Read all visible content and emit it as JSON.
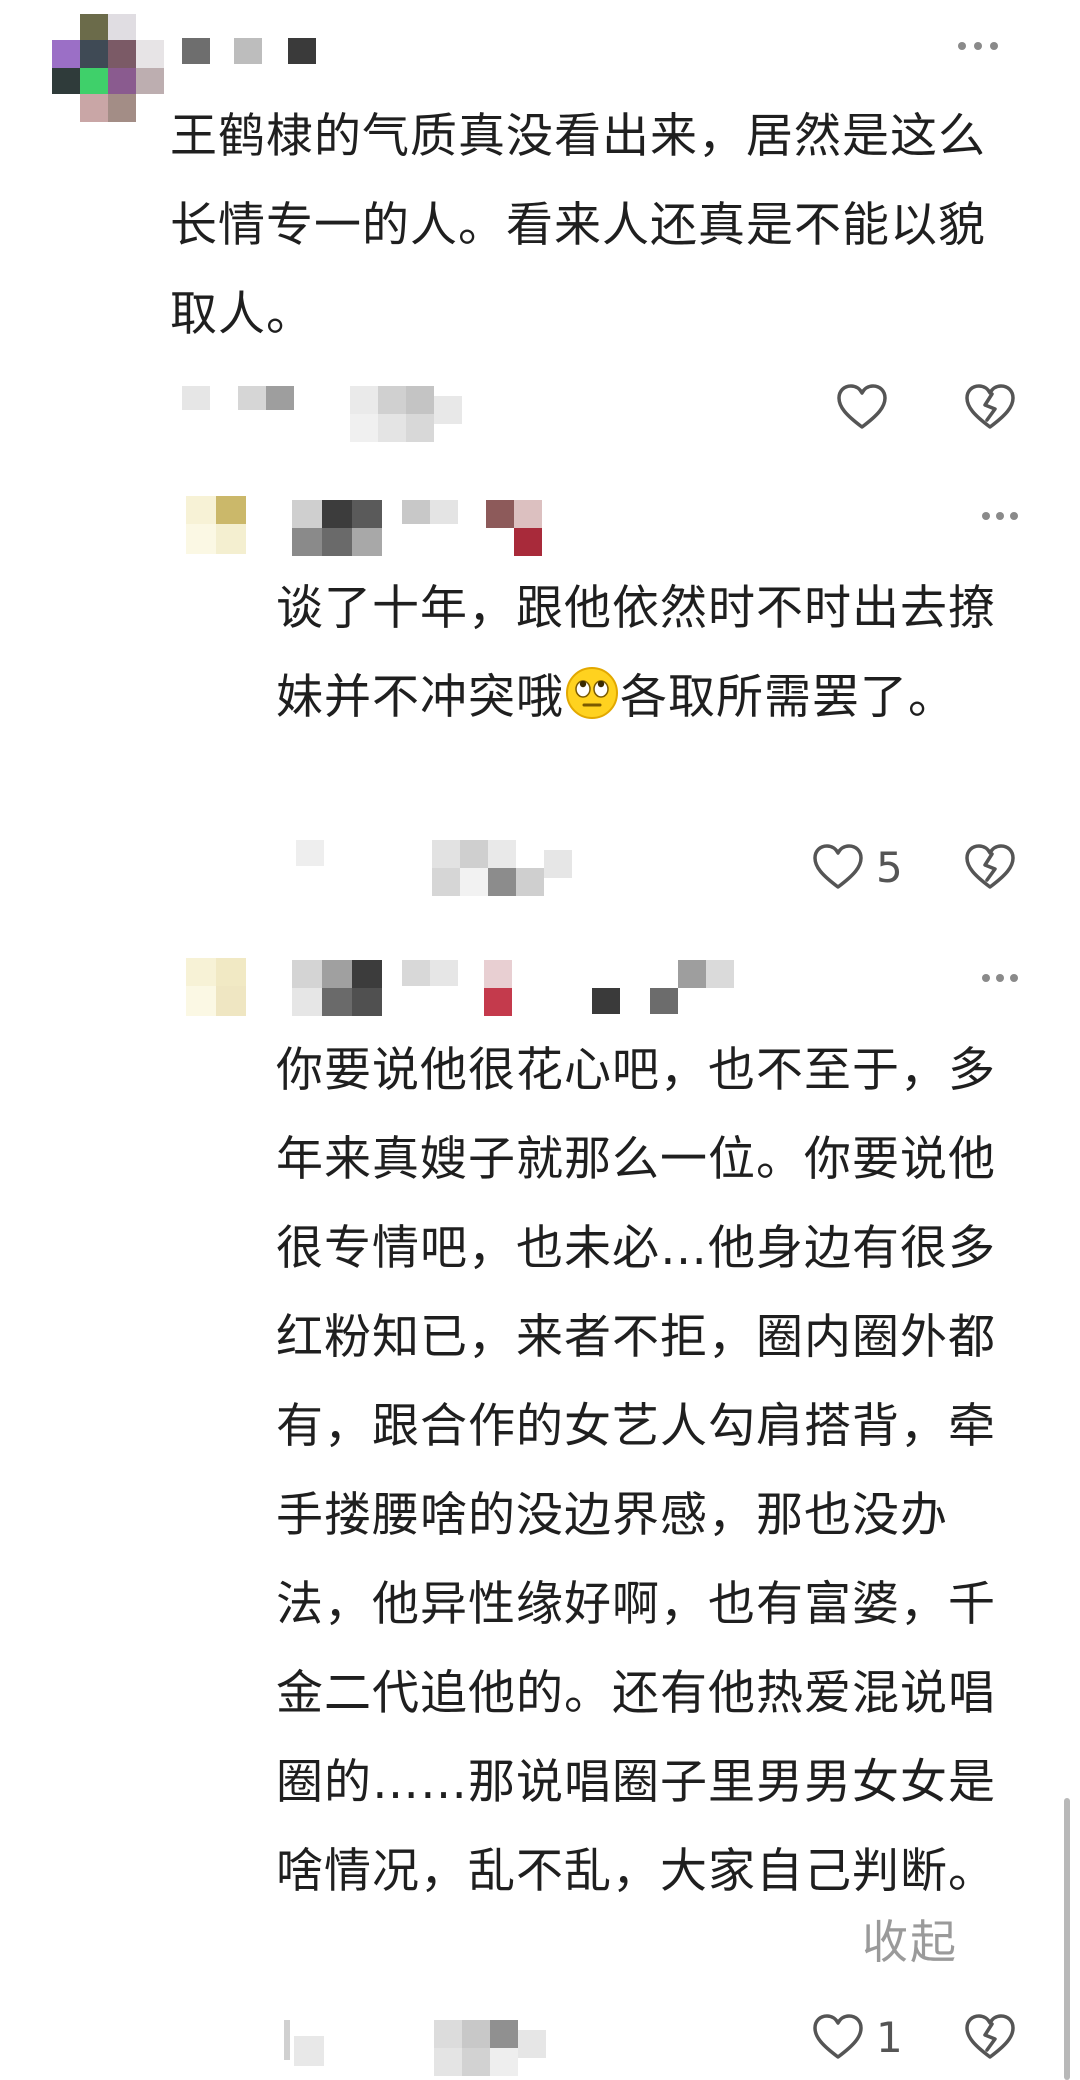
{
  "comments": [
    {
      "text": "王鹤棣的气质真没看出来，居然是这么长情专一的人。看来人还真是不能以貌取人。",
      "avatar_icon": "pixelated-avatar",
      "username_icon": "pixelated-username",
      "like_count": ""
    },
    {
      "text_before_emoji": "谈了十年，跟他依然时不时出去撩妹并不冲突哦",
      "emoji_icon": "eye-roll-emoji",
      "text_after_emoji": "各取所需罢了。",
      "avatar_icon": "pixelated-avatar",
      "username_icon": "pixelated-username",
      "like_count": "5"
    },
    {
      "text": "你要说他很花心吧，也不至于，多年来真嫂子就那么一位。你要说他很专情吧，也未必…他身边有很多红粉知已，来者不拒，圈内圈外都有，跟合作的女艺人勾肩搭背，牵手搂腰啥的没边界感，那也没办法，他异性缘好啊，也有富婆，千金二代追他的。还有他热爱混说唱圈的……那说唱圈子里男男女女是啥情况，乱不乱，大家自己判断。",
      "collapse_label": "收起",
      "avatar_icon": "pixelated-avatar",
      "username_icon": "pixelated-username",
      "like_count": "1"
    }
  ],
  "icons": {
    "like": "heart-outline-icon",
    "dislike": "broken-heart-icon",
    "more": "more-dots-icon"
  },
  "colors": {
    "text": "#1f1f1f",
    "secondary": "#9a9a9a",
    "icon": "#555555"
  }
}
